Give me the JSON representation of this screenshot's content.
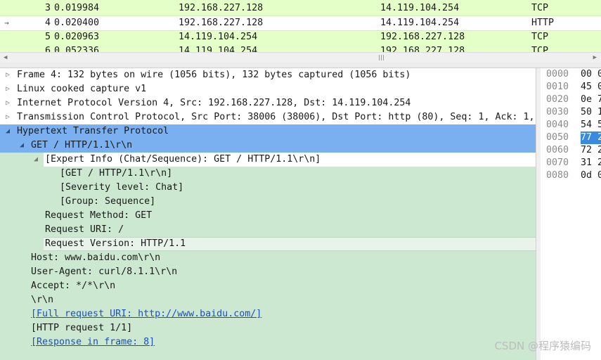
{
  "packet_list": {
    "rows": [
      {
        "no": "3",
        "time": "0.019984",
        "src": "192.168.227.128",
        "dst": "14.119.104.254",
        "proto": "TCP"
      },
      {
        "no": "4",
        "time": "0.020400",
        "src": "192.168.227.128",
        "dst": "14.119.104.254",
        "proto": "HTTP",
        "selected": true
      },
      {
        "no": "5",
        "time": "0.020963",
        "src": "14.119.104.254",
        "dst": "192.168.227.128",
        "proto": "TCP"
      },
      {
        "no": "6",
        "time": "0.052336",
        "src": "14.119.104.254",
        "dst": "192.168.227.128",
        "proto": "TCP"
      }
    ],
    "selected_arrow": "→"
  },
  "details": {
    "frame": "Frame 4: 132 bytes on wire (1056 bits), 132 bytes captured (1056 bits)",
    "linux": "Linux cooked capture v1",
    "ip": "Internet Protocol Version 4, Src: 192.168.227.128, Dst: 14.119.104.254",
    "tcp": "Transmission Control Protocol, Src Port: 38006 (38006), Dst Port: http (80), Seq: 1, Ack: 1,",
    "http": "Hypertext Transfer Protocol",
    "get": "GET / HTTP/1.1\\r\\n",
    "expert": "[Expert Info (Chat/Sequence): GET / HTTP/1.1\\r\\n]",
    "expert_get": "[GET / HTTP/1.1\\r\\n]",
    "severity": "[Severity level: Chat]",
    "group": "[Group: Sequence]",
    "method": "Request Method: GET",
    "uri": "Request URI: /",
    "version": "Request Version: HTTP/1.1",
    "host": "Host: www.baidu.com\\r\\n",
    "ua": "User-Agent: curl/8.1.1\\r\\n",
    "accept": "Accept: */*\\r\\n",
    "crlf": "\\r\\n",
    "full_uri": "[Full request URI: http://www.baidu.com/]",
    "req_num": "[HTTP request 1/1]",
    "resp_frame": "[Response in frame: 8]"
  },
  "bytes": {
    "rows": [
      {
        "off": "0000",
        "hex": "00 0"
      },
      {
        "off": "0010",
        "hex": "45 0"
      },
      {
        "off": "0020",
        "hex": "0e 7"
      },
      {
        "off": "0030",
        "hex": "50 1"
      },
      {
        "off": "0040",
        "hex": "54 5"
      },
      {
        "off": "0050",
        "hex": "77 2",
        "selected": true
      },
      {
        "off": "0060",
        "hex": "72 2"
      },
      {
        "off": "0070",
        "hex": "31 2"
      },
      {
        "off": "0080",
        "hex": "0d 0"
      }
    ]
  },
  "watermark": "CSDN @程序猿编码",
  "icons": {
    "collapsed": "▷",
    "expanded": "◢",
    "scroll_left": "◀",
    "scroll_right": "▶"
  },
  "colors": {
    "packet_bg": "#e4ffc7",
    "tree_bg": "#cce8d0",
    "selection": "#7ab0f0",
    "link": "#1b4fc5",
    "bytes_selection": "#3a8be0"
  }
}
